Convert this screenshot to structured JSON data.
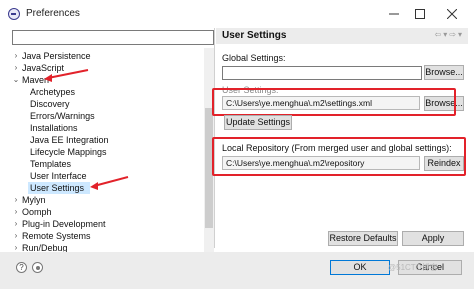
{
  "window": {
    "title": "Preferences",
    "minimize_icon": "minimize-icon",
    "maximize_icon": "maximize-icon",
    "close_icon": "close-icon"
  },
  "tree": {
    "items": [
      {
        "label": "Java Persistence",
        "expander": "›"
      },
      {
        "label": "JavaScript",
        "expander": "›"
      },
      {
        "label": "Maven",
        "expander": "⌄"
      },
      {
        "label": "Archetypes"
      },
      {
        "label": "Discovery"
      },
      {
        "label": "Errors/Warnings"
      },
      {
        "label": "Installations"
      },
      {
        "label": "Java EE Integration"
      },
      {
        "label": "Lifecycle Mappings"
      },
      {
        "label": "Templates"
      },
      {
        "label": "User Interface"
      },
      {
        "label": "User Settings"
      },
      {
        "label": "Mylyn",
        "expander": "›"
      },
      {
        "label": "Oomph",
        "expander": "›"
      },
      {
        "label": "Plug-in Development",
        "expander": "›"
      },
      {
        "label": "Remote Systems",
        "expander": "›"
      },
      {
        "label": "Run/Debug",
        "expander": "›"
      }
    ],
    "selected": "User Settings"
  },
  "page": {
    "title": "User Settings",
    "global_settings_label": "Global Settings:",
    "global_settings_value": "",
    "browse_label": "Browse...",
    "user_settings_label": "User Settings:",
    "user_settings_value": "C:\\Users\\ye.menghua\\.m2\\settings.xml",
    "update_settings_label": "Update Settings",
    "local_repo_label": "Local Repository (From merged user and global settings):",
    "local_repo_value": "C:\\Users\\ye.menghua\\.m2\\repository",
    "reindex_label": "Reindex",
    "restore_defaults_label": "Restore Defaults",
    "apply_label": "Apply"
  },
  "footer": {
    "ok_label": "OK",
    "cancel_label": "Cancel"
  },
  "watermark": "@51CTO博客",
  "colors": {
    "highlight_red": "#e2222a",
    "selection": "#cde8ff",
    "default_button_border": "#0078d7"
  }
}
